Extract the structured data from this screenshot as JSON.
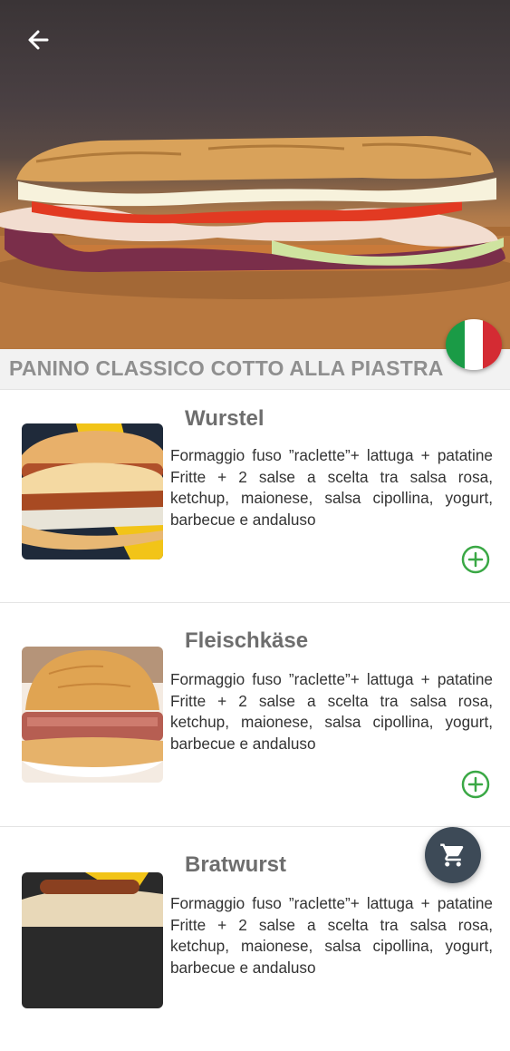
{
  "header": {
    "back_icon": "arrow-left-icon",
    "flag_icon": "italy-flag-icon",
    "flag_colors": [
      "#1a9b46",
      "#ffffff",
      "#d42b33"
    ]
  },
  "section": {
    "title": "PANINO CLASSICO COTTO ALLA PIASTRA"
  },
  "items": [
    {
      "name": "Wurstel",
      "description": "Formaggio fuso ”raclette”+ lattuga + patatine Fritte + 2 salse a scelta tra salsa rosa, ketchup, maionese, salsa cipollina, yogurt, barbecue e andaluso",
      "add_icon": "plus-circle-icon"
    },
    {
      "name": "Fleischkäse",
      "description": "Formaggio fuso ”raclette”+ lattuga + patatine Fritte + 2 salse a scelta tra salsa rosa, ketchup, maionese, salsa cipollina, yogurt, barbecue e andaluso",
      "add_icon": "plus-circle-icon"
    },
    {
      "name": "Bratwurst",
      "description": "Formaggio fuso ”raclette”+ lattuga + patatine Fritte + 2 salse a scelta tra salsa rosa, ketchup, maionese, salsa cipollina, yogurt, barbecue e andaluso",
      "add_icon": "plus-circle-icon"
    }
  ],
  "cart": {
    "icon": "cart-icon"
  },
  "colors": {
    "accent_green": "#3aa845",
    "cart_bg": "#3d4a57"
  }
}
